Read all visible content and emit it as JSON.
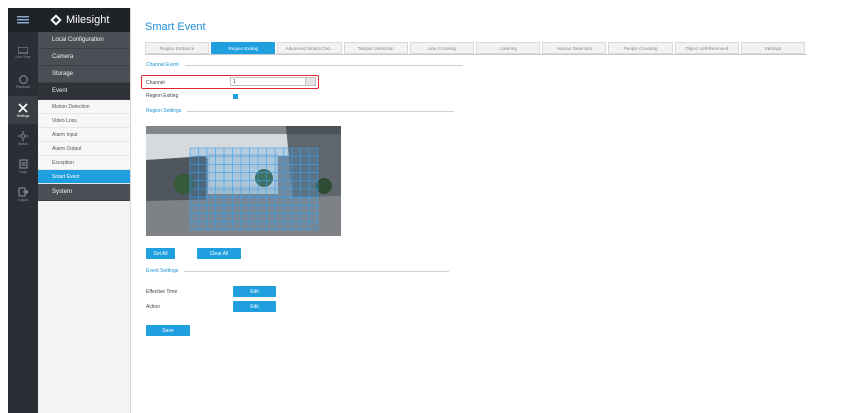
{
  "app": {
    "brand": "Milesight"
  },
  "rail": [
    {
      "name": "live-view",
      "label": "Live View"
    },
    {
      "name": "playback",
      "label": "Playback"
    },
    {
      "name": "settings",
      "label": "Settings"
    },
    {
      "name": "status",
      "label": "Status"
    },
    {
      "name": "logs",
      "label": "Logs"
    },
    {
      "name": "logout",
      "label": "Logout"
    }
  ],
  "sidebar": {
    "local_configuration": "Local Configuration",
    "camera": "Camera",
    "storage": "Storage",
    "event": "Event",
    "event_items": [
      "Motion Detection",
      "Video Loss",
      "Alarm Input",
      "Alarm Output",
      "Exception",
      "Smart Event"
    ],
    "system": "System"
  },
  "page": {
    "title": "Smart Event",
    "tabs": [
      "Region Entrance",
      "Region Exiting",
      "Advanced Motion Det...",
      "Tamper Detection",
      "Line Crossing",
      "Loitering",
      "Human Detection",
      "People Counting",
      "Object Left/Removed",
      "Settings"
    ],
    "active_tab": "Region Exiting"
  },
  "channel_event": {
    "section_title": "Channel Event",
    "channel_label": "Channel",
    "channel_value": "1",
    "region_exiting_label": "Region Exiting",
    "region_exiting_checked": true
  },
  "region_settings": {
    "section_title": "Region Settings",
    "set_all": "Set All",
    "clear_all": "Clear All"
  },
  "event_settings": {
    "section_title": "Event Settings",
    "effective_time_label": "Effective Time",
    "action_label": "Action",
    "edit": "Edit",
    "save": "Save"
  },
  "colors": {
    "accent": "#1f9ee0",
    "highlight": "#e0262b",
    "rail": "#2b2f35"
  }
}
